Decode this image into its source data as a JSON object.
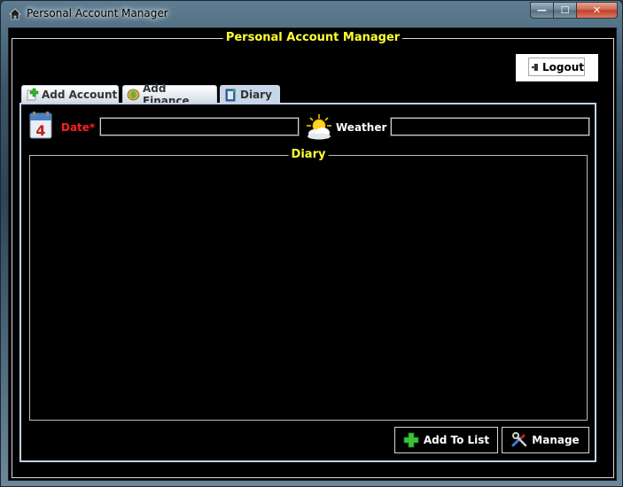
{
  "window": {
    "title": "Personal Account Manager",
    "controls": {
      "minimize": "—",
      "maximize": "☐",
      "close": "✕"
    }
  },
  "main": {
    "group_title": "Personal Account Manager",
    "logout_label": "Logout"
  },
  "tabs": [
    {
      "label": "Add Account",
      "icon": "add-icon",
      "active": false
    },
    {
      "label": "Add Finance",
      "icon": "money-icon",
      "active": false
    },
    {
      "label": "Diary",
      "icon": "diary-icon",
      "active": true
    }
  ],
  "diary_form": {
    "date_label": "Date* :",
    "date_value": "",
    "weather_label": "Weather :",
    "weather_value": "",
    "diary_title": "Diary",
    "diary_text": "",
    "add_button": "Add To List",
    "manage_button": "Manage"
  },
  "colors": {
    "accent_title": "#ffff33",
    "required_label": "#ff2020",
    "panel_border": "#c3d3e8",
    "background": "#000000"
  }
}
